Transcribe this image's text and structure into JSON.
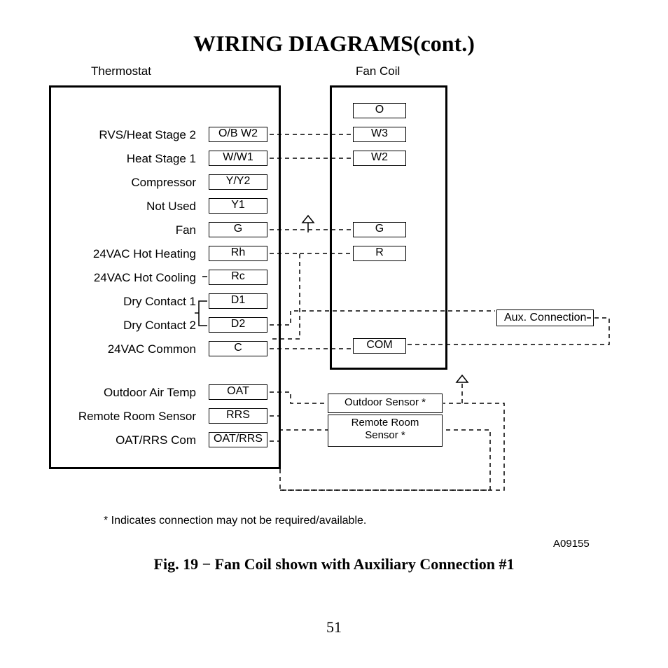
{
  "title": "WIRING DIAGRAMS(cont.)",
  "headers": {
    "thermostat": "Thermostat",
    "fancoil": "Fan Coil"
  },
  "thermostat": [
    {
      "label": "RVS/Heat Stage 2",
      "term": "O/B W2"
    },
    {
      "label": "Heat Stage 1",
      "term": "W/W1"
    },
    {
      "label": "Compressor",
      "term": "Y/Y2"
    },
    {
      "label": "Not Used",
      "term": "Y1"
    },
    {
      "label": "Fan",
      "term": "G"
    },
    {
      "label": "24VAC Hot Heating",
      "term": "Rh"
    },
    {
      "label": "24VAC Hot Cooling",
      "term": "Rc"
    },
    {
      "label": "Dry Contact 1",
      "term": "D1"
    },
    {
      "label": "Dry Contact 2",
      "term": "D2"
    },
    {
      "label": "24VAC Common",
      "term": "C"
    },
    {
      "label": "Outdoor Air Temp",
      "term": "OAT"
    },
    {
      "label": "Remote Room Sensor",
      "term": "RRS"
    },
    {
      "label": "OAT/RRS Com",
      "term": "OAT/RRS"
    }
  ],
  "fancoil": [
    {
      "term": "O"
    },
    {
      "term": "W3"
    },
    {
      "term": "W2"
    },
    {
      "term": "G"
    },
    {
      "term": "R"
    },
    {
      "term": "COM"
    }
  ],
  "aux": "Aux. Connection",
  "sensors": {
    "outdoor": "Outdoor Sensor *",
    "remote": "Remote Room\nSensor *"
  },
  "note": "*   Indicates connection may not be required/available.",
  "refnum": "A09155",
  "caption": "Fig. 19 − Fan Coil shown with Auxiliary Connection #1",
  "pagenum": "51"
}
